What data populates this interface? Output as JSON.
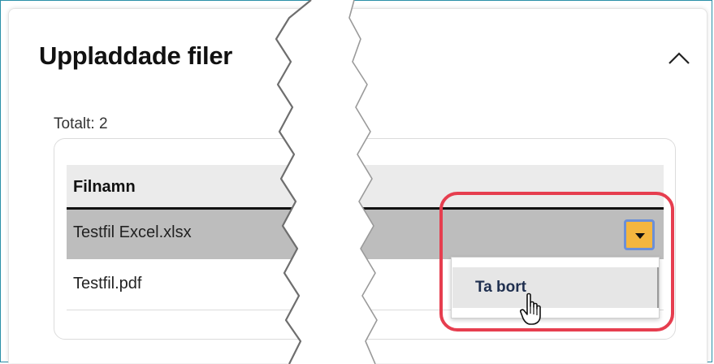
{
  "panel": {
    "title": "Uppladdade filer",
    "collapse_icon": "chevron-up-icon",
    "total_label": "Totalt: 2"
  },
  "table": {
    "columns": [
      "Filnamn"
    ],
    "rows": [
      {
        "filename": "Testfil Excel.xlsx",
        "selected": true
      },
      {
        "filename": "Testfil.pdf",
        "selected": false
      }
    ],
    "row_action_icon": "caret-down-icon"
  },
  "dropdown_menu": {
    "items": [
      "Ta bort"
    ]
  },
  "colors": {
    "accent_button": "#f4b63f",
    "focus_ring": "#6b8fd8",
    "highlight_outline": "#e63e4f",
    "selected_row": "#bdbdbd"
  }
}
